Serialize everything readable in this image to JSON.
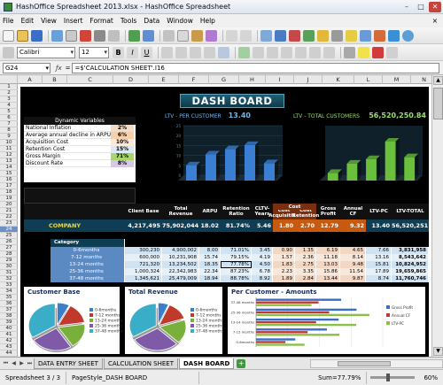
{
  "window": {
    "title": "HashOffice Spreadsheet 2013.xlsx - HashOffice Spreadsheet"
  },
  "menu": [
    "File",
    "Edit",
    "View",
    "Insert",
    "Format",
    "Tools",
    "Data",
    "Window",
    "Help"
  ],
  "menu_close": "×",
  "toolbar2": {
    "font_name": "Calibri",
    "font_size": "12"
  },
  "formula": {
    "cell_ref": "G24",
    "fx": "ƒx",
    "eq": "=",
    "content": "=$'CALCULATION SHEET'.I16"
  },
  "columns": [
    "A",
    "B",
    "C",
    "D",
    "E",
    "F",
    "G",
    "H",
    "I",
    "J",
    "K",
    "L",
    "M",
    "N"
  ],
  "rows": [
    "1",
    "2",
    "3",
    "4",
    "5",
    "6",
    "7",
    "8",
    "9",
    "10",
    "11",
    "12",
    "13",
    "14",
    "15",
    "16",
    "17",
    "18",
    "19",
    "20",
    "21",
    "22",
    "23",
    "24",
    "25",
    "26",
    "27",
    "28",
    "29",
    "30",
    "31",
    "32",
    "33",
    "34",
    "35",
    "36",
    "37",
    "38",
    "39",
    "40",
    "41",
    "42",
    "43",
    "44"
  ],
  "selected_row": "24",
  "dashboard": {
    "title": "DASH BOARD",
    "dynamic_variables": {
      "title": "Dynamic Variables",
      "rows": [
        {
          "label": "National Inflation",
          "value": "2%"
        },
        {
          "label": "Average annual decline in ARPU",
          "value": "6%"
        },
        {
          "label": "Acquisition Cost",
          "value": "10%"
        },
        {
          "label": "Retention Cost",
          "value": "15%"
        },
        {
          "label": "Gross Margin",
          "value": "71%"
        },
        {
          "label": "Discount Rate",
          "value": "8%"
        }
      ]
    },
    "ltv_per_customer": {
      "label": "LTV - PER CUSTOMER",
      "value": "13.40"
    },
    "ltv_total": {
      "label": "LTV - TOTAL CUSTOMERS",
      "value": "56,520,250.84"
    },
    "headers": [
      "Client Base",
      "Total Revenue",
      "ARPU",
      "Retention Ratio",
      "CLTV-Years",
      "Cost Acquisition",
      "Cost Retention",
      "Gross Profit",
      "Annual CF",
      "LTV-PC",
      "LTV-TOTAL"
    ],
    "cost_group": "Cost",
    "company": {
      "label": "COMPANY",
      "values": [
        "4,217,495",
        "75,902,044",
        "18.02",
        "81.74%",
        "5.46",
        "1.80",
        "2.70",
        "12.79",
        "9.32",
        "13.40",
        "56,520,251"
      ]
    },
    "category_header": "Category",
    "categories": [
      {
        "name": "0-6months",
        "values": [
          "300,230",
          "4,900,002",
          "8.00",
          "71.01%",
          "3.45",
          "0.90",
          "1.35",
          "6.19",
          "4.65",
          "7.66",
          "3,831,958"
        ]
      },
      {
        "name": "7-12 months",
        "values": [
          "600,000",
          "10,231,908",
          "15.74",
          "79.15%",
          "4.19",
          "1.57",
          "2.36",
          "11.18",
          "8.14",
          "13.16",
          "8,543,642"
        ]
      },
      {
        "name": "13-24 months",
        "values": [
          "721,320",
          "13,234,502",
          "18.35",
          "77.78%",
          "4.50",
          "1.83",
          "2.75",
          "13.03",
          "9.48",
          "15.81",
          "10,824,952"
        ]
      },
      {
        "name": "25-36 months",
        "values": [
          "1,000,324",
          "22,342,983",
          "22.34",
          "87.23%",
          "6.78",
          "2.23",
          "3.35",
          "15.86",
          "11.54",
          "17.89",
          "19,659,865"
        ]
      },
      {
        "name": "37-48 months",
        "values": [
          "1,345,621",
          "25,479,009",
          "18.94",
          "88.78%",
          "8.92",
          "1.89",
          "2.84",
          "13.44",
          "9.87",
          "8.74",
          "11,760,746"
        ]
      }
    ],
    "customer_base_title": "Customer Base",
    "total_revenue_title": "Total Revenue",
    "per_customer_title": "Per Customer - Amounts",
    "pie_legend": [
      "0-6months",
      "7-12 months",
      "13-24 months",
      "25-36 months",
      "37-48 months"
    ],
    "bar_legend": [
      "Gross Profit",
      "Annual CF",
      "LTV-PC"
    ]
  },
  "chart_data": [
    {
      "type": "bar",
      "title": "LTV - PER CUSTOMER",
      "categories": [
        "0-6months",
        "7-12 months",
        "13-24 months",
        "25-36 months",
        "37-48 months"
      ],
      "values": [
        7.66,
        13.16,
        15.81,
        17.89,
        8.74
      ],
      "ylim": [
        0,
        25
      ]
    },
    {
      "type": "bar",
      "title": "LTV - TOTAL CUSTOMERS",
      "categories": [
        "0-6months",
        "7-12 months",
        "13-24 months",
        "25-36 months",
        "37-48 months"
      ],
      "values": [
        3831958,
        8543642,
        10824952,
        19659865,
        11760746
      ]
    },
    {
      "type": "pie",
      "title": "Customer Base",
      "categories": [
        "0-6months",
        "7-12 months",
        "13-24 months",
        "25-36 months",
        "37-48 months"
      ],
      "values": [
        300230,
        600000,
        721320,
        1000324,
        1345621
      ]
    },
    {
      "type": "pie",
      "title": "Total Revenue",
      "categories": [
        "0-6months",
        "7-12 months",
        "13-24 months",
        "25-36 months",
        "37-48 months"
      ],
      "values": [
        4900002,
        10231908,
        13234502,
        22342983,
        25479009
      ]
    },
    {
      "type": "bar",
      "title": "Per Customer - Amounts",
      "categories": [
        "37-48 months",
        "25-36 months",
        "13-24 months",
        "7-12 months",
        "0-6months"
      ],
      "series": [
        {
          "name": "Gross Profit",
          "values": [
            13.44,
            15.86,
            13.03,
            11.18,
            6.19
          ]
        },
        {
          "name": "Annual CF",
          "values": [
            9.87,
            11.54,
            9.48,
            8.14,
            4.65
          ]
        },
        {
          "name": "LTV-PC",
          "values": [
            8.74,
            17.89,
            15.81,
            13.16,
            7.66
          ]
        }
      ],
      "xlim": [
        0,
        20
      ]
    }
  ],
  "colors": {
    "pie": [
      "#3b7ec9",
      "#c0392b",
      "#78b03a",
      "#7e5aa8",
      "#3aaec9"
    ],
    "ltv_pc": "#3a7fd4",
    "ltv_total": "#6ac03a",
    "bars": [
      "#3b6ec9",
      "#c0392b",
      "#8ac04a"
    ]
  },
  "sheet_tabs": [
    "DATA ENTRY SHEET",
    "CALCULATION SHEET",
    "DASH BOARD"
  ],
  "active_tab": "DASH BOARD",
  "status": {
    "sheet": "Spreadsheet 3 / 3",
    "page_style": "PageStyle_DASH BOARD",
    "sum": "Sum=77.79%",
    "zoom": "60%"
  }
}
